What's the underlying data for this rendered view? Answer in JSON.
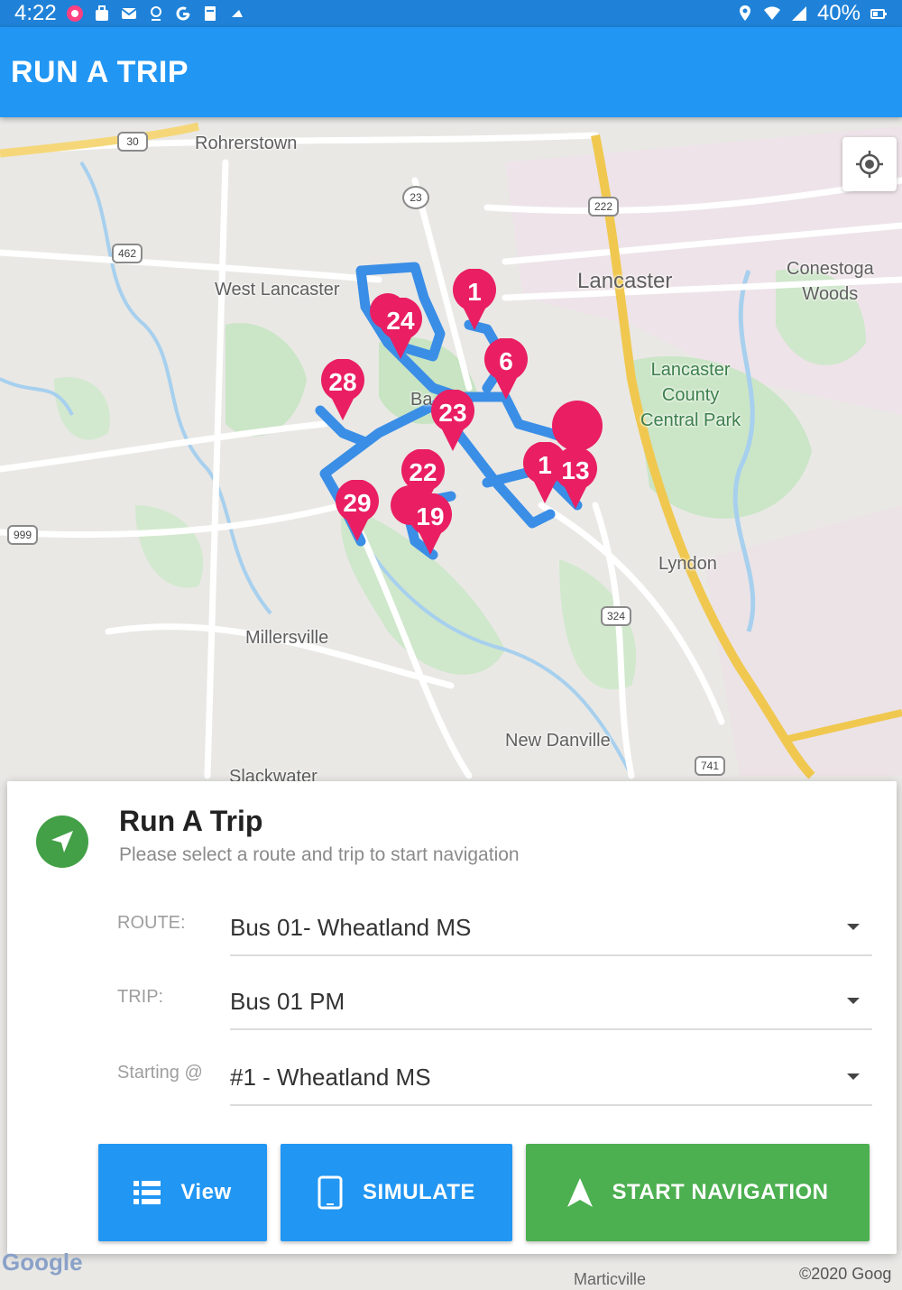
{
  "status_bar": {
    "time": "4:22",
    "battery": "40%"
  },
  "app_bar": {
    "title": "RUN A TRIP"
  },
  "map": {
    "place_labels": {
      "rohrerstown": "Rohrerstown",
      "west_lancaster": "West Lancaster",
      "lancaster": "Lancaster",
      "conestoga": "Conestoga\nWoods",
      "lancaster_county_park": "Lancaster\nCounty\nCentral Park",
      "lyndon": "Lyndon",
      "millersville": "Millersville",
      "new_danville": "New Danville",
      "slackwater": "Slackwater",
      "marticville": "Marticville",
      "bausman": "Ba"
    },
    "road_shields": [
      "30",
      "23",
      "222",
      "462",
      "999",
      "324",
      "741"
    ],
    "stop_markers": [
      "1",
      "24",
      "6",
      "28",
      "23",
      "22",
      "1",
      "13",
      "29",
      "19"
    ],
    "route_color": "#3a8ee6",
    "marker_color": "#e91e63",
    "attribution": "©2020 Goog",
    "google_logo": "Google"
  },
  "panel": {
    "title": "Run A Trip",
    "subtitle": "Please select a route and trip to start navigation",
    "route_label": "ROUTE:",
    "route_value": "Bus 01- Wheatland MS",
    "trip_label": "TRIP:",
    "trip_value": "Bus 01 PM",
    "starting_label": "Starting @",
    "starting_value": "#1 - Wheatland MS",
    "buttons": {
      "view": "View",
      "simulate": "SIMULATE",
      "start_navigation": "START NAVIGATION"
    },
    "colors": {
      "primary": "#2196f3",
      "success": "#4caf50"
    }
  }
}
